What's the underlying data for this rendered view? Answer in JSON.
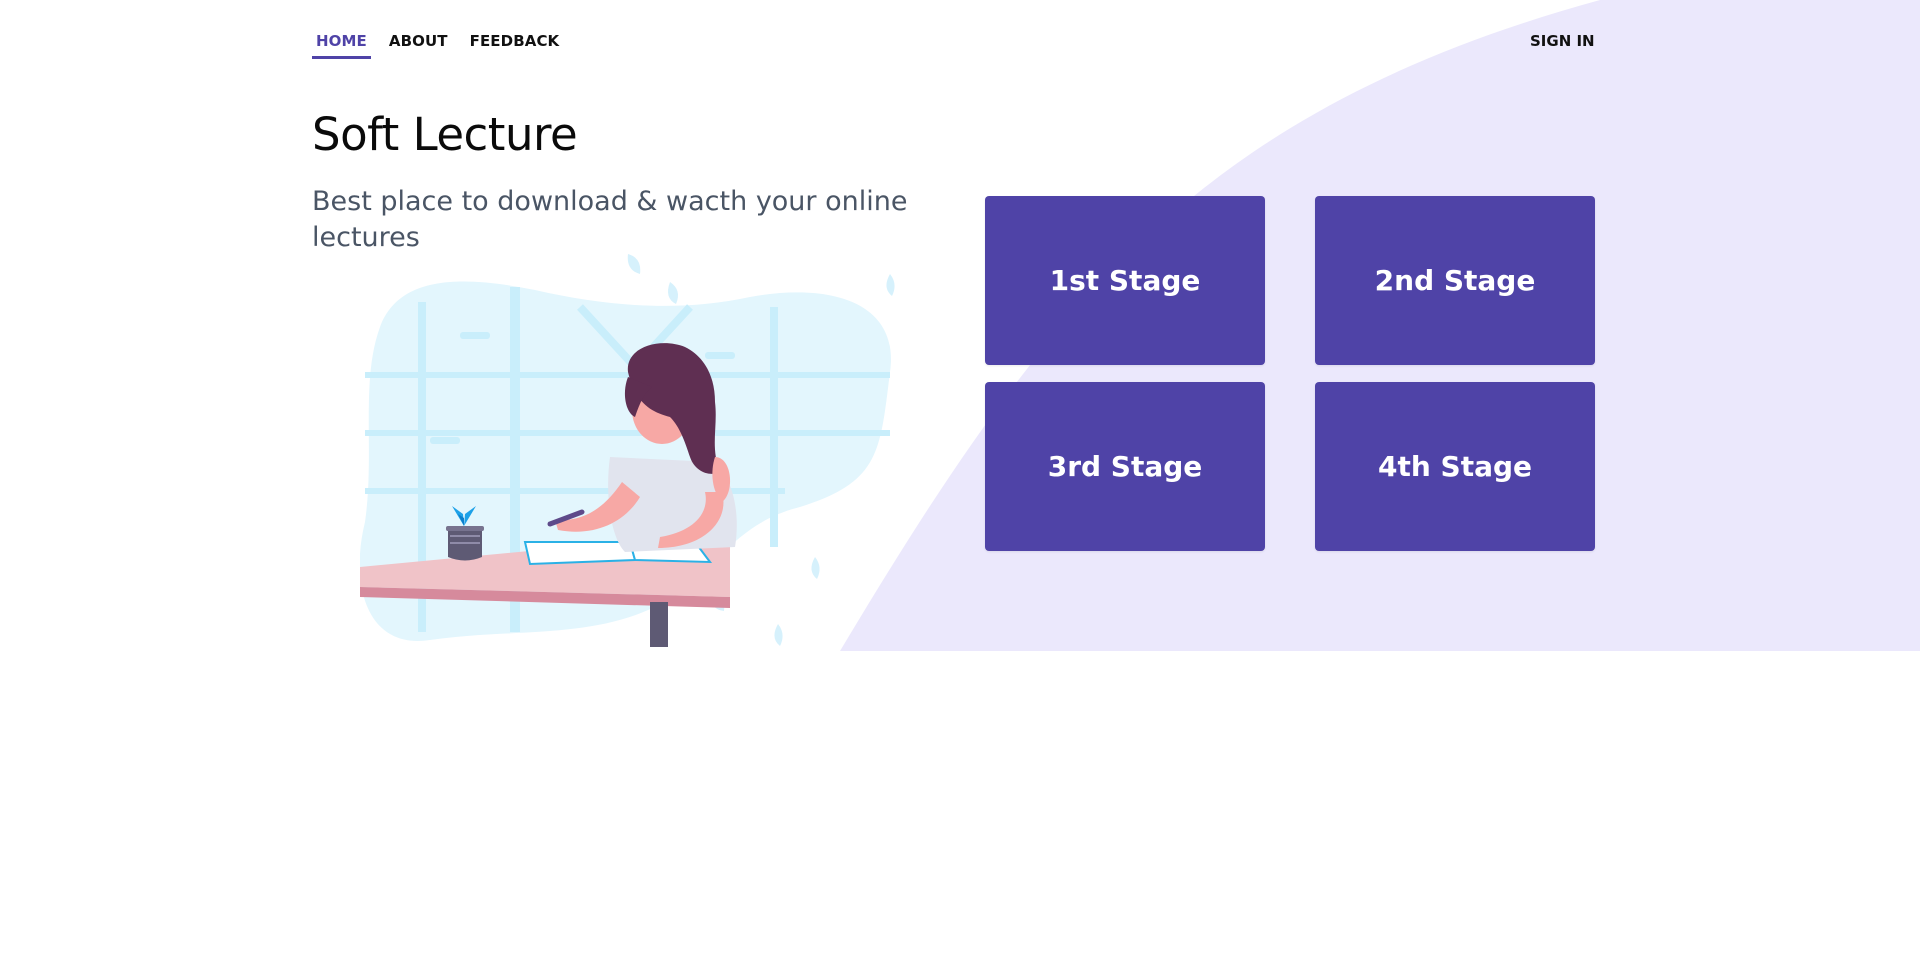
{
  "nav": {
    "items": [
      {
        "label": "HOME",
        "active": true
      },
      {
        "label": "ABOUT",
        "active": false
      },
      {
        "label": "FEEDBACK",
        "active": false
      }
    ],
    "sign_in": "SIGN IN"
  },
  "hero": {
    "title": "Soft Lecture",
    "subtitle": "Best place to download & wacth your online lectures"
  },
  "stages": [
    {
      "label": "1st Stage"
    },
    {
      "label": "2nd Stage"
    },
    {
      "label": "3rd Stage"
    },
    {
      "label": "4th Stage"
    }
  ],
  "colors": {
    "accent": "#4f43a7",
    "wave_background": "#ebe8fc",
    "text_dark": "#0a0a0a",
    "text_muted": "#4a5565"
  },
  "illustration": {
    "icon": "woman-studying-illustration"
  }
}
